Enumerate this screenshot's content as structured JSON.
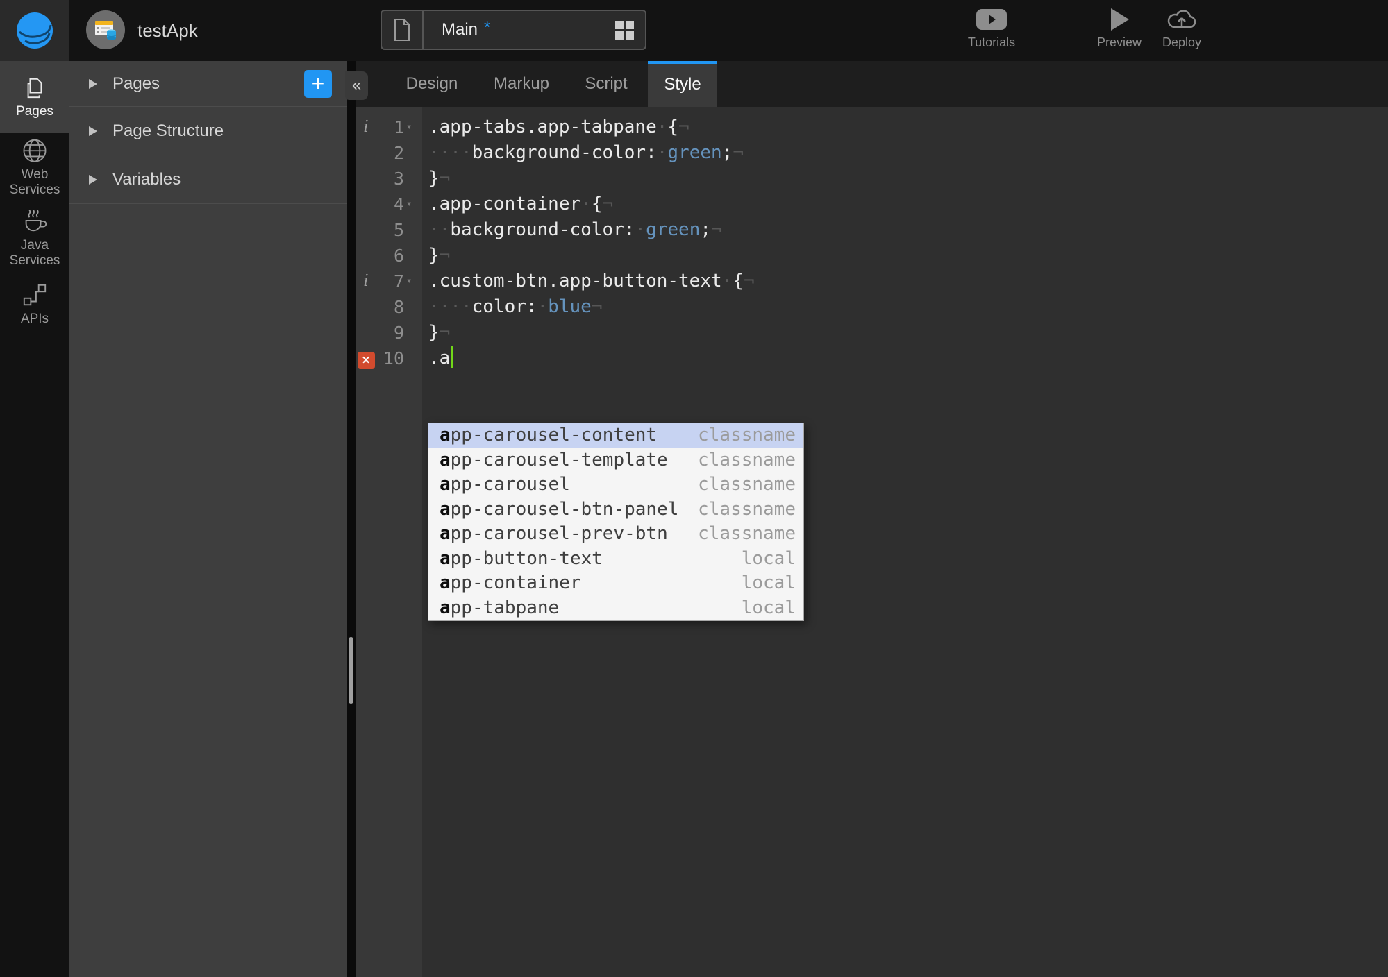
{
  "colors": {
    "accent_blue": "#2196f3",
    "error_red": "#d24b2e",
    "cursor_green": "#72d819",
    "css_value_blue": "#6593bd",
    "autocomplete_selection": "#c7d3f2"
  },
  "header": {
    "project_name": "testApk",
    "page_tab": {
      "label": "Main",
      "dirty_marker": "*"
    },
    "actions": {
      "tutorials": "Tutorials",
      "preview": "Preview",
      "deploy": "Deploy"
    }
  },
  "rail": {
    "items": [
      {
        "label": "Pages",
        "active": true
      },
      {
        "label": "Web Services",
        "active": false
      },
      {
        "label": "Java Services",
        "active": false
      },
      {
        "label": "APIs",
        "active": false
      }
    ]
  },
  "panel": {
    "sections": [
      {
        "label": "Pages",
        "has_add_button": true
      },
      {
        "label": "Page Structure"
      },
      {
        "label": "Variables"
      }
    ],
    "add_button_glyph": "+",
    "collapse_glyph": "«"
  },
  "editor": {
    "tabs": [
      {
        "label": "Design",
        "active": false
      },
      {
        "label": "Markup",
        "active": false
      },
      {
        "label": "Script",
        "active": false
      },
      {
        "label": "Style",
        "active": true
      }
    ],
    "gutter_glyphs": {
      "info": "i",
      "fold": "▾",
      "error": "✕"
    },
    "whitespace_glyphs": {
      "space": "·",
      "eol": "¬"
    },
    "lines": [
      {
        "num": 1,
        "info": true,
        "fold": true,
        "tokens": [
          {
            "t": ".app-tabs.app-tabpane",
            "c": "b"
          },
          {
            "t": "·",
            "c": "w"
          },
          {
            "t": "{",
            "c": "b"
          },
          {
            "t": "¬",
            "c": "e"
          }
        ]
      },
      {
        "num": 2,
        "tokens": [
          {
            "t": "····",
            "c": "w"
          },
          {
            "t": "background-color:",
            "c": "b"
          },
          {
            "t": "·",
            "c": "w"
          },
          {
            "t": "green",
            "c": "v"
          },
          {
            "t": ";",
            "c": "b"
          },
          {
            "t": "¬",
            "c": "e"
          }
        ]
      },
      {
        "num": 3,
        "tokens": [
          {
            "t": "}",
            "c": "b"
          },
          {
            "t": "¬",
            "c": "e"
          }
        ]
      },
      {
        "num": 4,
        "fold": true,
        "tokens": [
          {
            "t": ".app-container",
            "c": "b"
          },
          {
            "t": "·",
            "c": "w"
          },
          {
            "t": "{",
            "c": "b"
          },
          {
            "t": "¬",
            "c": "e"
          }
        ]
      },
      {
        "num": 5,
        "tokens": [
          {
            "t": "··",
            "c": "w"
          },
          {
            "t": "background-color:",
            "c": "b"
          },
          {
            "t": "·",
            "c": "w"
          },
          {
            "t": "green",
            "c": "v"
          },
          {
            "t": ";",
            "c": "b"
          },
          {
            "t": "¬",
            "c": "e"
          }
        ]
      },
      {
        "num": 6,
        "tokens": [
          {
            "t": "}",
            "c": "b"
          },
          {
            "t": "¬",
            "c": "e"
          }
        ]
      },
      {
        "num": 7,
        "info": true,
        "fold": true,
        "tokens": [
          {
            "t": ".custom-btn.app-button-text",
            "c": "b"
          },
          {
            "t": "·",
            "c": "w"
          },
          {
            "t": "{",
            "c": "b"
          },
          {
            "t": "¬",
            "c": "e"
          }
        ]
      },
      {
        "num": 8,
        "tokens": [
          {
            "t": "····",
            "c": "w"
          },
          {
            "t": "color:",
            "c": "b"
          },
          {
            "t": "·",
            "c": "w"
          },
          {
            "t": "blue",
            "c": "v"
          },
          {
            "t": "¬",
            "c": "e"
          }
        ]
      },
      {
        "num": 9,
        "tokens": [
          {
            "t": "}",
            "c": "b"
          },
          {
            "t": "¬",
            "c": "e"
          }
        ]
      },
      {
        "num": 10,
        "error": true,
        "cursor": true,
        "tokens": [
          {
            "t": ".a",
            "c": "b"
          }
        ]
      }
    ],
    "autocomplete": {
      "match": "a",
      "items": [
        {
          "name": "app-carousel-content",
          "type": "classname",
          "selected": true
        },
        {
          "name": "app-carousel-template",
          "type": "classname"
        },
        {
          "name": "app-carousel",
          "type": "classname"
        },
        {
          "name": "app-carousel-btn-panel",
          "type": "classname"
        },
        {
          "name": "app-carousel-prev-btn",
          "type": "classname"
        },
        {
          "name": "app-button-text",
          "type": "local"
        },
        {
          "name": "app-container",
          "type": "local"
        },
        {
          "name": "app-tabpane",
          "type": "local"
        }
      ]
    }
  }
}
